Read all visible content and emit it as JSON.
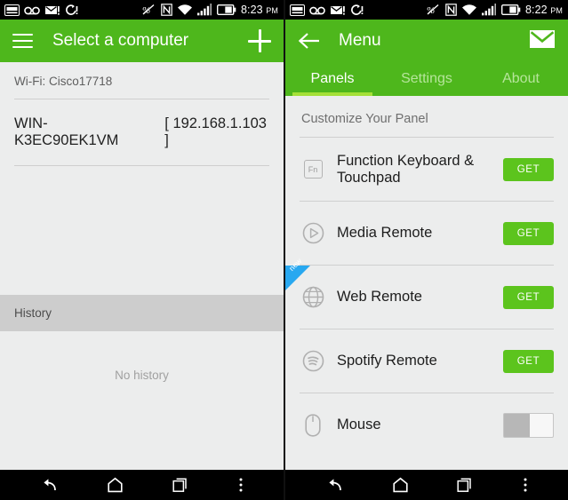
{
  "left": {
    "status": {
      "time": "8:23",
      "ampm": "PM",
      "icons": [
        "sim-card-icon",
        "voicemail-icon",
        "email-icon",
        "sync-icon",
        "vibrate-off-icon",
        "nfc-icon",
        "wifi-icon",
        "signal-icon",
        "battery-icon"
      ]
    },
    "appbar": {
      "title": "Select a computer",
      "menu_icon": "hamburger-icon",
      "add_icon": "plus-icon"
    },
    "wifi_label": "Wi-Fi: Cisco17718",
    "computer": {
      "name": "WIN-K3EC90EK1VM",
      "ip": "[ 192.168.1.103 ]"
    },
    "history": {
      "header": "History",
      "empty_text": "No history"
    }
  },
  "right": {
    "status": {
      "time": "8:22",
      "ampm": "PM",
      "icons": [
        "sim-card-icon",
        "voicemail-icon",
        "email-icon",
        "sync-icon",
        "vibrate-off-icon",
        "nfc-icon",
        "wifi-icon",
        "signal-icon",
        "battery-icon"
      ]
    },
    "appbar": {
      "title": "Menu",
      "back_icon": "back-arrow-icon",
      "mail_icon": "envelope-icon"
    },
    "tabs": [
      {
        "label": "Panels",
        "active": true
      },
      {
        "label": "Settings",
        "active": false
      },
      {
        "label": "About",
        "active": false
      }
    ],
    "section_title": "Customize Your Panel",
    "items": [
      {
        "label": "Function Keyboard & Touchpad",
        "icon": "fn-key-icon",
        "icon_text": "Fn",
        "action": "GET",
        "control": "button",
        "badge": null
      },
      {
        "label": "Media Remote",
        "icon": "play-circle-icon",
        "action": "GET",
        "control": "button",
        "badge": null
      },
      {
        "label": "Web Remote",
        "icon": "globe-icon",
        "action": "GET",
        "control": "button",
        "badge": "new"
      },
      {
        "label": "Spotify Remote",
        "icon": "spotify-icon",
        "action": "GET",
        "control": "button",
        "badge": null
      },
      {
        "label": "Mouse",
        "icon": "mouse-icon",
        "action": "",
        "control": "toggle",
        "badge": null,
        "toggle_on": false
      }
    ]
  },
  "navbar": {
    "back": "back-icon",
    "home": "home-icon",
    "recents": "recents-icon",
    "more": "overflow-menu-icon"
  },
  "colors": {
    "green": "#4eb71c",
    "get_green": "#5cc41d",
    "tab_indicator": "#a5e038",
    "badge_blue": "#28a8f0",
    "bg": "#eceded"
  }
}
